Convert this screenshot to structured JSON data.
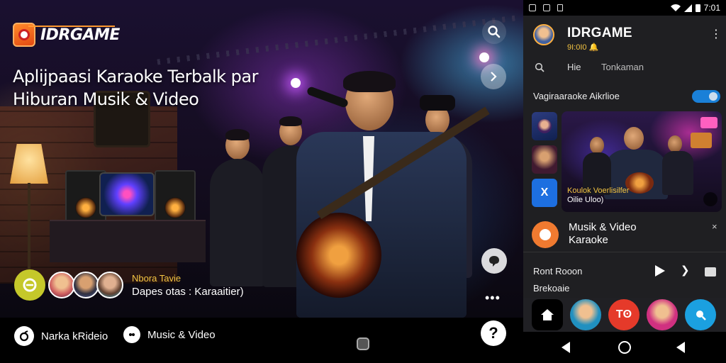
{
  "hero": {
    "logo_text": "IDRGAME",
    "headline_line1": "Aplijpaasi Karaoke Terbalk par",
    "headline_line2": "Hiburan Musik & Video",
    "chat_name": "Nbora Tavie",
    "chat_message": "Dapes otas : Karaaitier)",
    "bottom_left_label": "Narka kRideio",
    "bottom_mid_label": "Music & Video",
    "help_symbol": "?",
    "more_symbol": "•••"
  },
  "phone": {
    "status_time": "7:01",
    "app_title": "IDRGAME",
    "app_subtitle": "9I:0I0 🔔",
    "kebab_symbol": "⋮",
    "tabs": [
      {
        "label": "Hie"
      },
      {
        "label": "Tonkaman"
      }
    ],
    "section_title": "Vagiraaraoke Aikrlioe",
    "feature_line1": "Koulok Voerlisilfer",
    "feature_line2": "Oilie Uloo)",
    "thumb3_label": "X",
    "musik_title": "Musik & Video",
    "musik_subtitle": "Karaoke",
    "close_symbol": "×",
    "player_title": "Ront Rooon",
    "player_subtitle": "Brekoaie",
    "next_symbol": "❯",
    "dock_tp_label": "Tʘ"
  },
  "colors": {
    "accent_orange": "#ff9a30",
    "accent_yellow": "#f5c542",
    "toggle_blue": "#1a80d8"
  }
}
